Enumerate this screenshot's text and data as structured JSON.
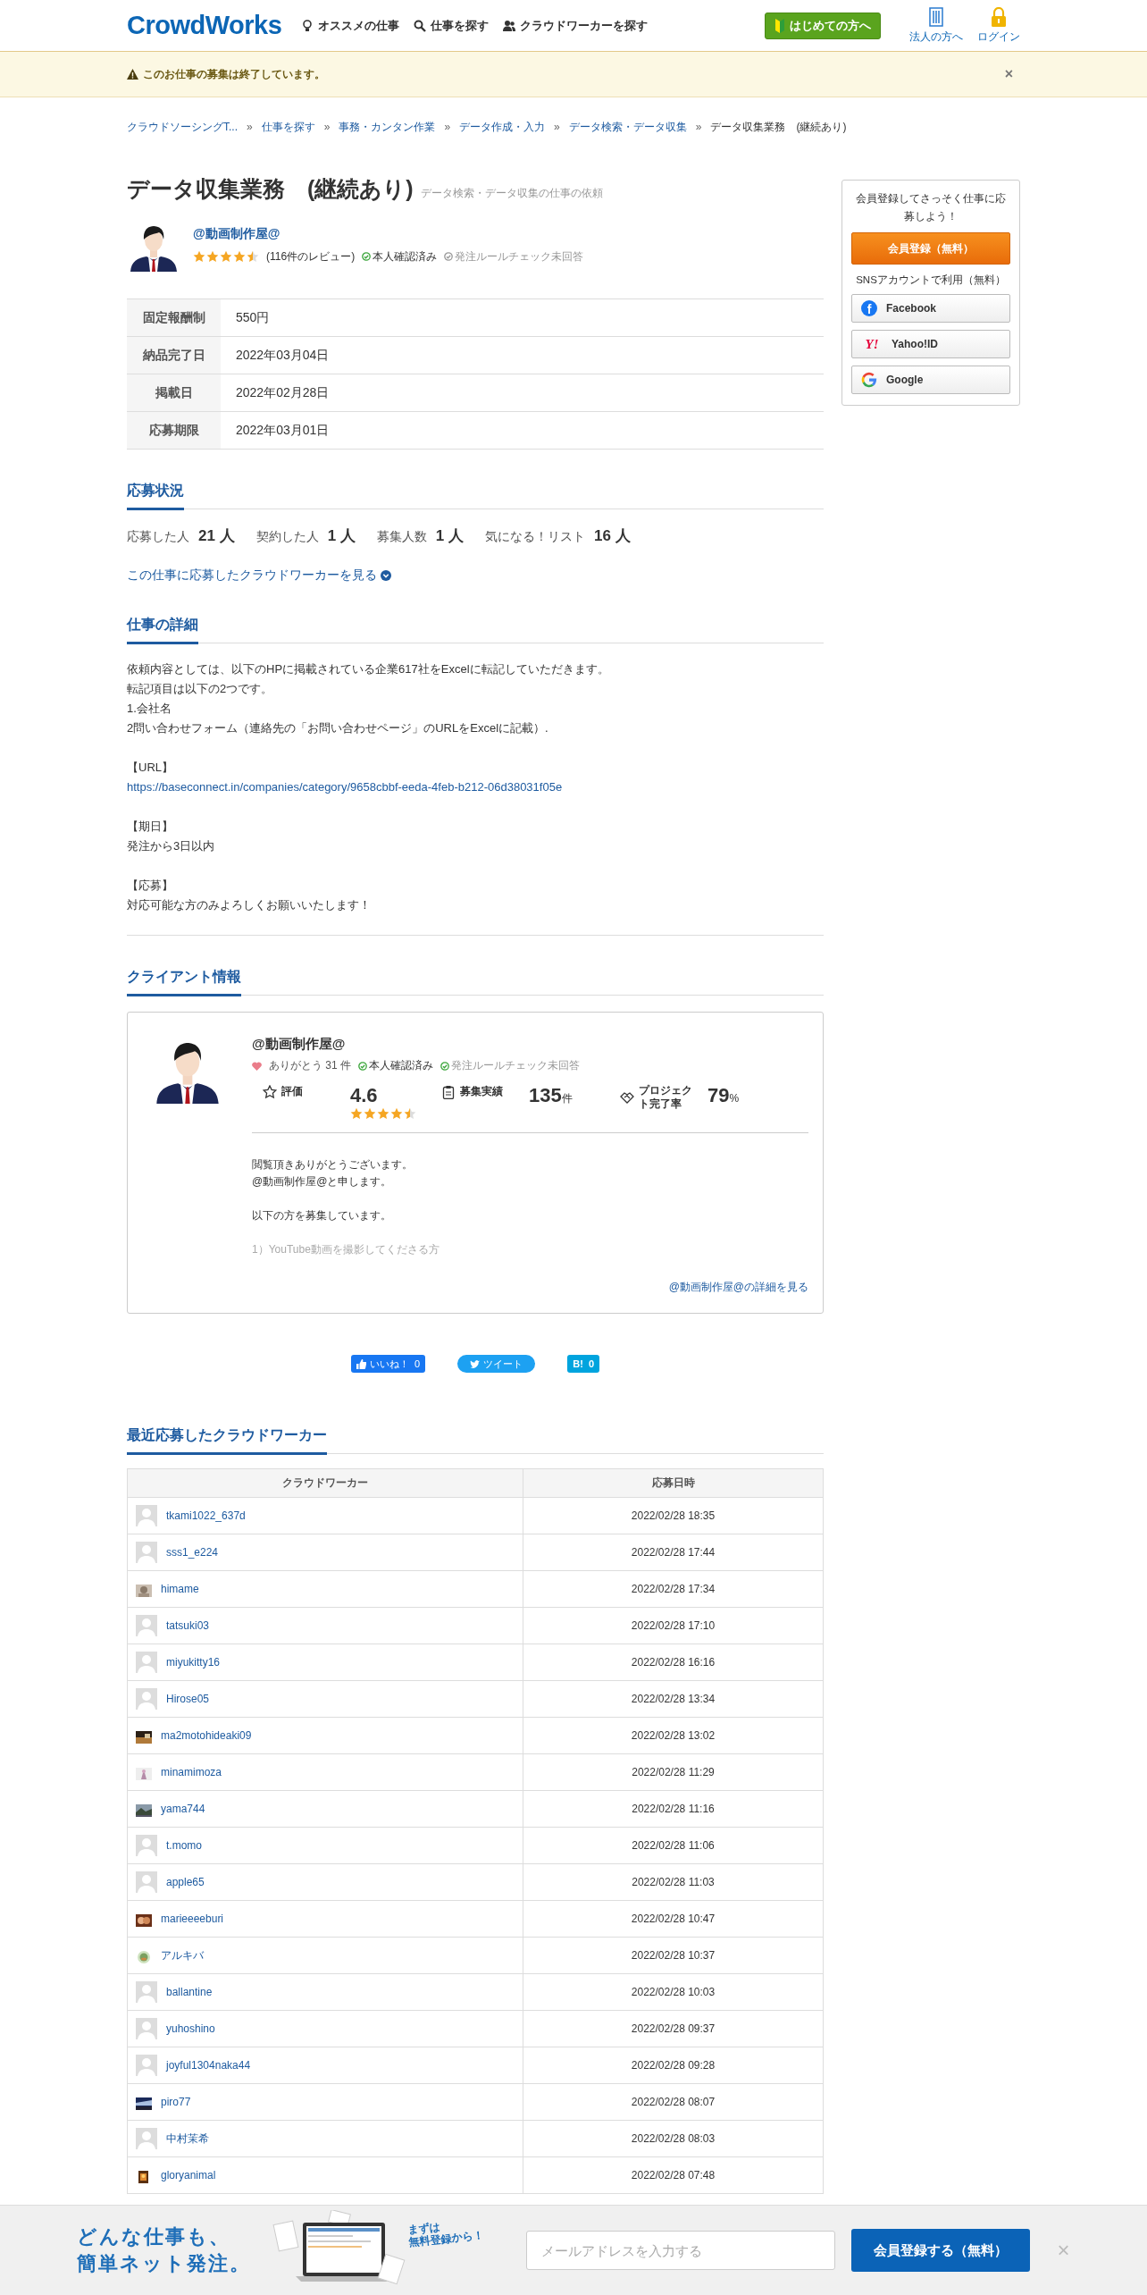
{
  "header": {
    "logo": "CrowdWorks",
    "nav": [
      {
        "label": "オススメの仕事"
      },
      {
        "label": "仕事を探す"
      },
      {
        "label": "クラウドワーカーを探す"
      }
    ],
    "beginner_button": "はじめての方へ",
    "links": [
      {
        "label": "法人の方へ"
      },
      {
        "label": "ログイン"
      }
    ]
  },
  "alert": {
    "message": "このお仕事の募集は終了しています。",
    "close": "×"
  },
  "breadcrumb": {
    "separator": "»",
    "items": [
      "クラウドソーシングT...",
      "仕事を探す",
      "事務・カンタン作業",
      "データ作成・入力",
      "データ検索・データ収集",
      "データ収集業務　(継続あり)"
    ]
  },
  "job": {
    "title": "データ収集業務　(継続あり)",
    "category": "データ検索・データ収集の仕事の依頼",
    "client": {
      "name": "@動画制作屋@",
      "stars": 4.5,
      "reviews": "(116件のレビュー)",
      "badges": [
        {
          "label": "本人確認済み",
          "verified": true
        },
        {
          "label": "発注ルールチェック未回答",
          "verified": false
        }
      ]
    },
    "info": [
      {
        "label": "固定報酬制",
        "value": "550円"
      },
      {
        "label": "納品完了日",
        "value": "2022年03月04日"
      },
      {
        "label": "掲載日",
        "value": "2022年02月28日"
      },
      {
        "label": "応募期限",
        "value": "2022年03月01日"
      }
    ]
  },
  "application_status": {
    "heading": "応募状況",
    "stats": [
      {
        "label": "応募した人",
        "value": "21 人"
      },
      {
        "label": "契約した人",
        "value": "1 人"
      },
      {
        "label": "募集人数",
        "value": "1 人"
      },
      {
        "label": "気になる！リスト",
        "value": "16 人"
      }
    ],
    "link": "この仕事に応募したクラウドワーカーを見る"
  },
  "details": {
    "heading": "仕事の詳細",
    "blocks": [
      [
        {
          "kind": "text",
          "text": "依頼内容としては、以下のHPに掲載されている企業617社をExcelに転記していただきます。"
        },
        {
          "kind": "text",
          "text": "転記項目は以下の2つです。"
        },
        {
          "kind": "text",
          "text": "1.会社名"
        },
        {
          "kind": "text",
          "text": "2問い合わせフォーム（連絡先の「お問い合わせページ」のURLをExcelに記載）."
        }
      ],
      [
        {
          "kind": "text",
          "text": "【URL】"
        },
        {
          "kind": "link",
          "text": "https://baseconnect.in/companies/category/9658cbbf-eeda-4feb-b212-06d38031f05e"
        }
      ],
      [
        {
          "kind": "text",
          "text": "【期日】"
        },
        {
          "kind": "text",
          "text": "発注から3日以内"
        }
      ],
      [
        {
          "kind": "text",
          "text": "【応募】"
        },
        {
          "kind": "text",
          "text": "対応可能な方のみよろしくお願いいたします！"
        }
      ]
    ]
  },
  "client_info": {
    "heading": "クライアント情報",
    "name": "@動画制作屋@",
    "thanks": "ありがとう 31 件",
    "badges": [
      {
        "label": "本人確認済み",
        "verified": true
      },
      {
        "label": "発注ルールチェック未回答",
        "verified": false
      }
    ],
    "stats": [
      {
        "kind": "rating",
        "label": "評価",
        "value": "4.6",
        "stars": 4.5
      },
      {
        "kind": "count",
        "label": "募集実績",
        "value": "135",
        "unit": "件"
      },
      {
        "kind": "rate",
        "label": "プロジェクト完了率",
        "value": "79",
        "unit": "%"
      }
    ],
    "intro": [
      [
        "閲覧頂きありがとうございます。",
        "@動画制作屋@と申します。"
      ],
      [
        "以下の方を募集しています。"
      ]
    ],
    "faded_line": "1）YouTube動画を撮影してくださる方",
    "more_link": "@動画制作屋@の詳細を見る"
  },
  "share": [
    {
      "kind": "facebook",
      "label": "いいね！",
      "count": "0"
    },
    {
      "kind": "twitter",
      "label": "ツイート"
    },
    {
      "kind": "hatena",
      "label": "B!",
      "count": "0"
    }
  ],
  "recent": {
    "heading": "最近応募したクラウドワーカー",
    "columns": [
      "クラウドワーカー",
      "応募日時"
    ],
    "rows": [
      {
        "name": "tkami1022_637d",
        "kind": "default",
        "date": "2022/02/28 18:35"
      },
      {
        "name": "sss1_e224",
        "kind": "default",
        "date": "2022/02/28 17:44"
      },
      {
        "name": "himame",
        "kind": "picture",
        "date": "2022/02/28 17:34"
      },
      {
        "name": "tatsuki03",
        "kind": "default",
        "date": "2022/02/28 17:10"
      },
      {
        "name": "miyukitty16",
        "kind": "default",
        "date": "2022/02/28 16:16"
      },
      {
        "name": "Hirose05",
        "kind": "default",
        "date": "2022/02/28 13:34"
      },
      {
        "name": "ma2motohideaki09",
        "kind": "picture",
        "date": "2022/02/28 13:02"
      },
      {
        "name": "minamimoza",
        "kind": "picture",
        "date": "2022/02/28 11:29"
      },
      {
        "name": "yama744",
        "kind": "picture",
        "date": "2022/02/28 11:16"
      },
      {
        "name": "t.momo",
        "kind": "default",
        "date": "2022/02/28 11:06"
      },
      {
        "name": "apple65",
        "kind": "default",
        "date": "2022/02/28 11:03"
      },
      {
        "name": "marieeeeburi",
        "kind": "picture",
        "date": "2022/02/28 10:47"
      },
      {
        "name": "アルキバ",
        "kind": "picture",
        "date": "2022/02/28 10:37"
      },
      {
        "name": "ballantine",
        "kind": "default",
        "date": "2022/02/28 10:03"
      },
      {
        "name": "yuhoshino",
        "kind": "default",
        "date": "2022/02/28 09:37"
      },
      {
        "name": "joyful1304naka44",
        "kind": "default",
        "date": "2022/02/28 09:28"
      },
      {
        "name": "piro77",
        "kind": "picture",
        "date": "2022/02/28 08:07"
      },
      {
        "name": "中村茉希",
        "kind": "default",
        "date": "2022/02/28 08:03"
      },
      {
        "name": "gloryanimal",
        "kind": "picture",
        "date": "2022/02/28 07:48"
      }
    ]
  },
  "sidebar": {
    "message": "会員登録してさっそく仕事に応募しよう！",
    "register": "会員登録（無料）",
    "sns_label": "SNSアカウントで利用（無料）",
    "sns": [
      {
        "kind": "facebook",
        "logo": "f",
        "label": "Facebook"
      },
      {
        "kind": "yahoo",
        "logo": "Y!",
        "label": "Yahoo!ID"
      },
      {
        "kind": "google",
        "label": "Google"
      }
    ]
  },
  "footer_banner": {
    "headline": [
      "どんな仕事も、",
      "簡単ネット発注。"
    ],
    "bubble": [
      "まずは",
      "無料登録から！"
    ],
    "email_placeholder": "メールアドレスを入力する",
    "button": "会員登録する（無料）",
    "close": "×"
  }
}
